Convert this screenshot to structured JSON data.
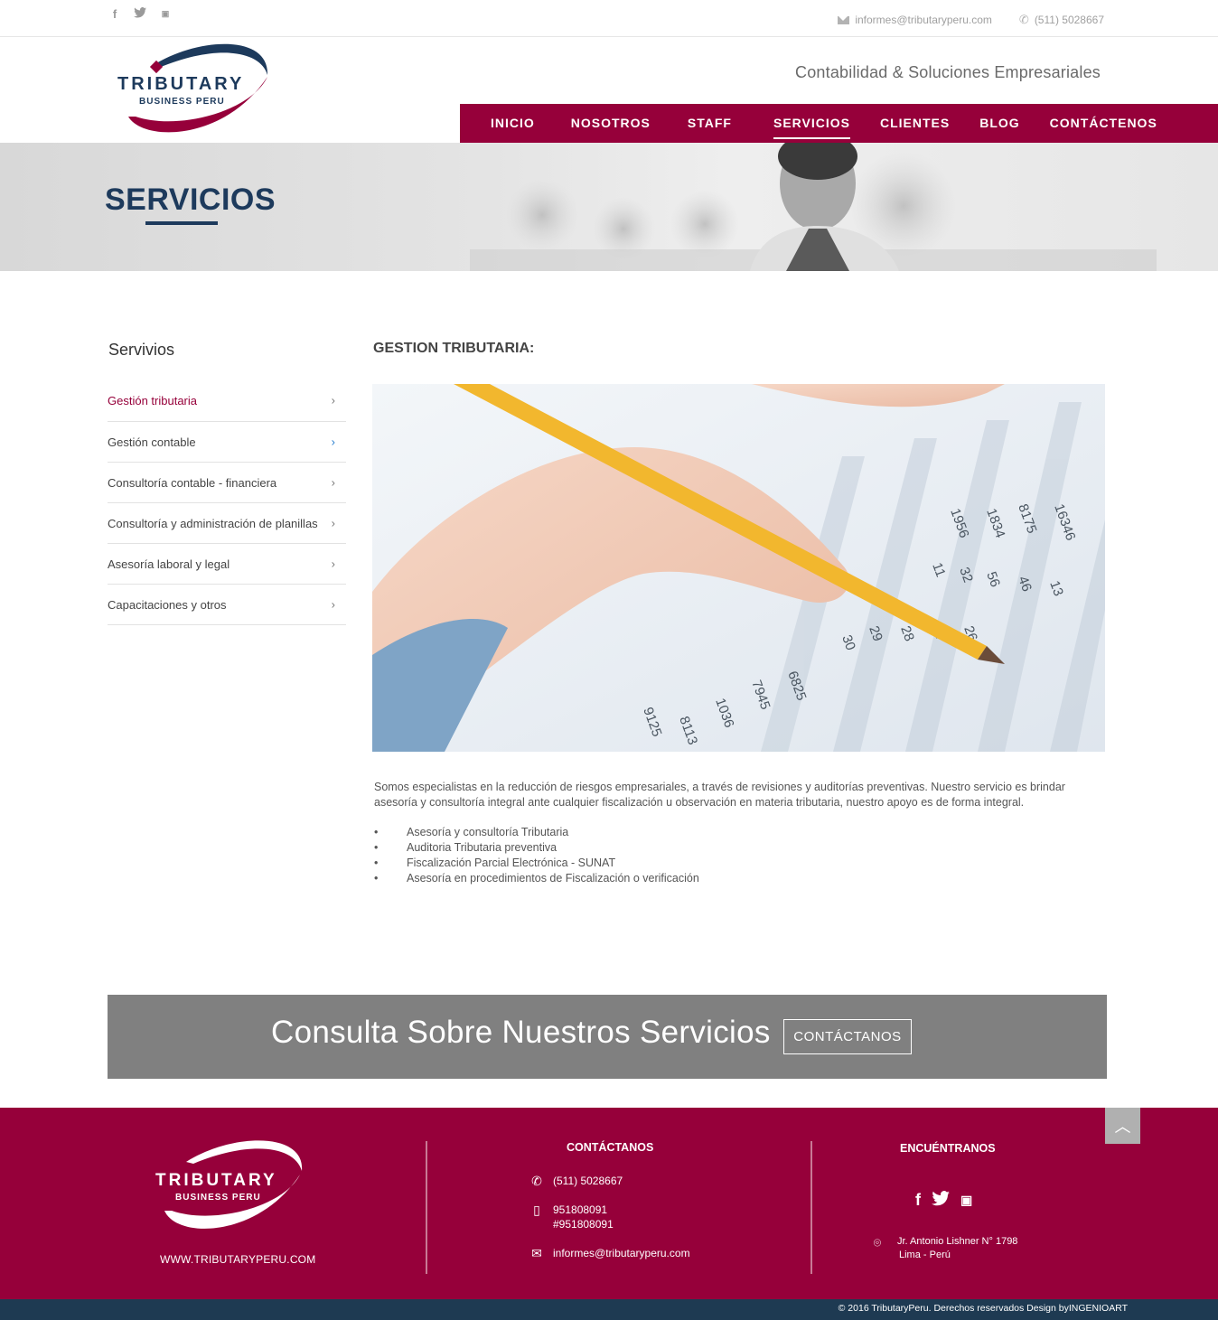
{
  "topbar": {
    "social": [
      "facebook-icon",
      "twitter-icon",
      "youtube-icon"
    ],
    "email": "informes@tributaryperu.com",
    "phone": "(511) 5028667"
  },
  "header": {
    "logo_line1": "TRIBUTARY",
    "logo_line2": "BUSINESS PERU",
    "tagline": "Contabilidad & Soluciones Empresariales",
    "nav": [
      "INICIO",
      "NOSOTROS",
      "STAFF",
      "SERVICIOS",
      "CLIENTES",
      "BLOG",
      "CONTÁCTENOS"
    ],
    "active_nav": "SERVICIOS"
  },
  "banner": {
    "title": "SERVICIOS"
  },
  "sidebar": {
    "title": "Servivios",
    "items": [
      {
        "label": "Gestión tributaria"
      },
      {
        "label": "Gestión contable"
      },
      {
        "label": "Consultoría contable - financiera"
      },
      {
        "label": "Consultoría y administración de planillas"
      },
      {
        "label": "Asesoría laboral y legal"
      },
      {
        "label": "Capacitaciones y otros"
      }
    ]
  },
  "main": {
    "title": "GESTION TRIBUTARIA:",
    "paragraph": "Somos especialistas en la reducción de riesgos empresariales, a través de revisiones y auditorías preventivas. Nuestro servicio es brindar asesoría y consultoría integral ante cualquier fiscalización u observación en materia tributaria, nuestro apoyo es de forma integral.",
    "bullets": [
      "Asesoría y consultoría Tributaria",
      "Auditoria Tributaria preventiva",
      "Fiscalización Parcial Electrónica - SUNAT",
      "Asesoría en procedimientos de Fiscalización o verificación"
    ],
    "bullet_symbol": "•"
  },
  "cta": {
    "text": "Consulta Sobre Nuestros Servicios",
    "button": "CONTÁCTANOS"
  },
  "footer": {
    "url": "WWW.TRIBUTARYPERU.COM",
    "contact_title": "CONTÁCTANOS",
    "phone": "(511) 5028667",
    "mobile1": "951808091",
    "mobile2": "#951808091",
    "email": "informes@tributaryperu.com",
    "find_title": "ENCUÉNTRANOS",
    "address1": "Jr. Antonio Lishner N° 1798",
    "address2": "Lima - Perú",
    "copyright": "© 2016  TributaryPeru. Derechos reservados Design byINGENIOART"
  },
  "colors": {
    "brand": "#96003a",
    "navy": "#1d3a5c",
    "cta_bg": "#808080"
  }
}
